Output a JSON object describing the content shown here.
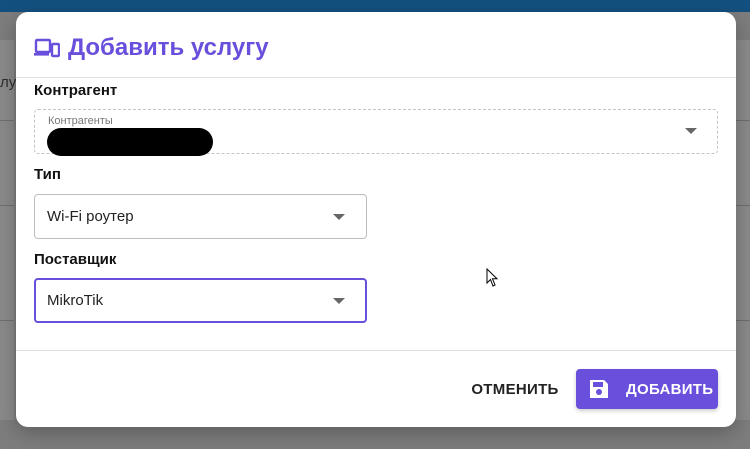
{
  "background": {
    "left_fragment": "лу"
  },
  "dialog": {
    "title": "Добавить услугу",
    "title_icon": "devices-icon",
    "accent_color": "#6a4fdc"
  },
  "fields": {
    "contractor": {
      "section_label": "Контрагент",
      "floating_label": "Контрагенты",
      "value_redacted": true
    },
    "type": {
      "section_label": "Тип",
      "value": "Wi-Fi роутер"
    },
    "supplier": {
      "section_label": "Поставщик",
      "value": "MikroTik"
    }
  },
  "actions": {
    "cancel_label": "ОТМЕНИТЬ",
    "add_label": "ДОБАВИТЬ",
    "add_icon": "save-icon"
  }
}
